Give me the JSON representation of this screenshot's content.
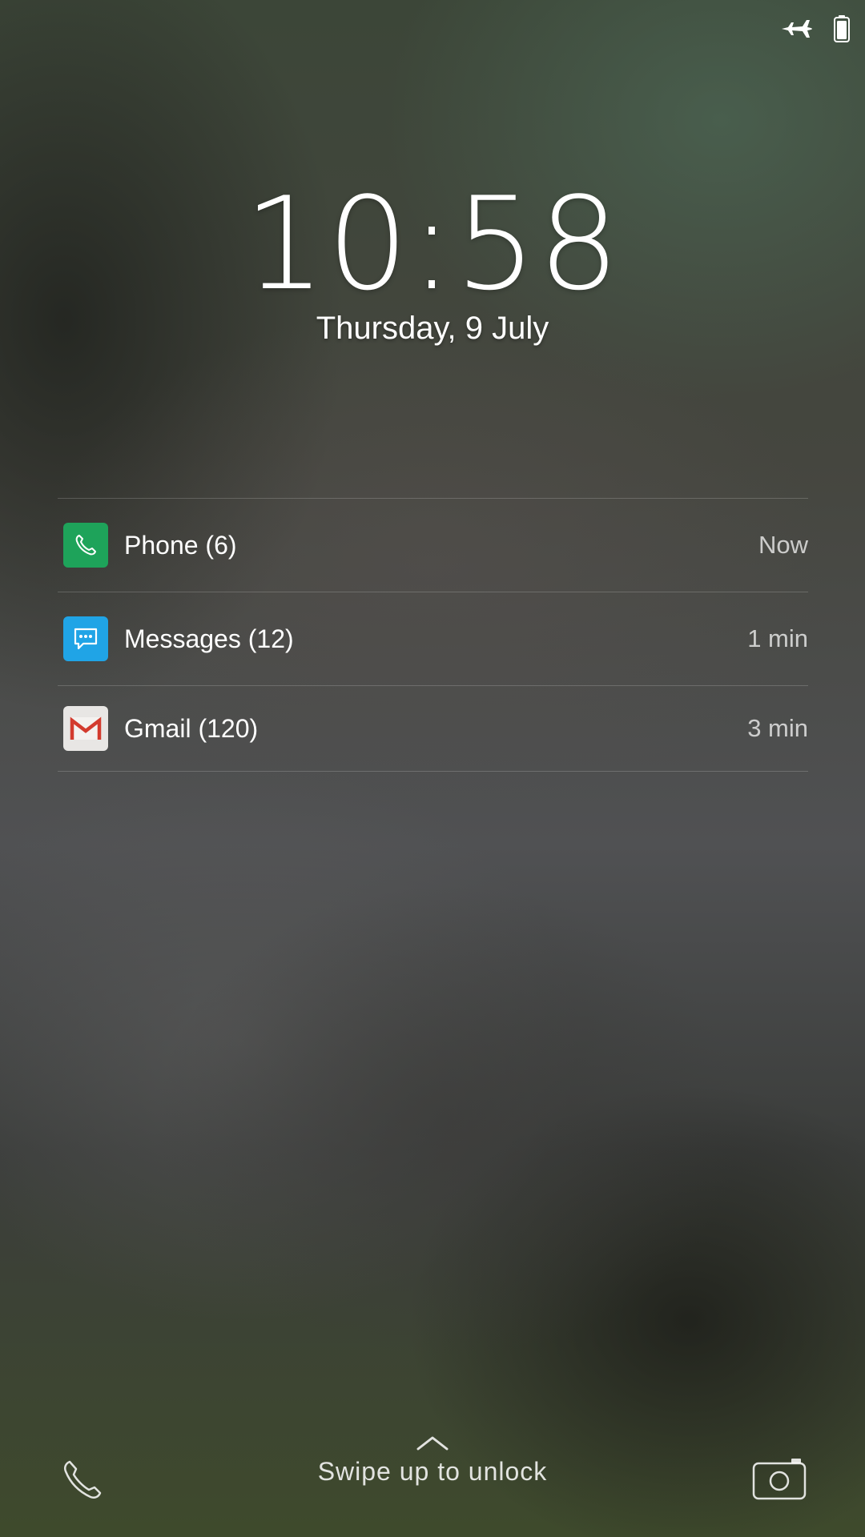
{
  "status_bar": {
    "airplane_icon": "airplane-icon",
    "battery_icon": "battery-icon"
  },
  "lockscreen": {
    "time": "10:58",
    "date": "Thursday, 9 July"
  },
  "notifications": [
    {
      "app": "Phone (6)",
      "time": "Now",
      "icon": "phone-app-icon",
      "color": "#1ea35a"
    },
    {
      "app": "Messages (12)",
      "time": "1 min",
      "icon": "messages-app-icon",
      "color": "#20a4e6"
    },
    {
      "app": "Gmail (120)",
      "time": "3 min",
      "icon": "gmail-app-icon",
      "color": "#e8e6e4"
    }
  ],
  "bottom": {
    "unlock_hint": "Swipe up to unlock",
    "left_icon": "phone-icon",
    "right_icon": "camera-icon"
  }
}
